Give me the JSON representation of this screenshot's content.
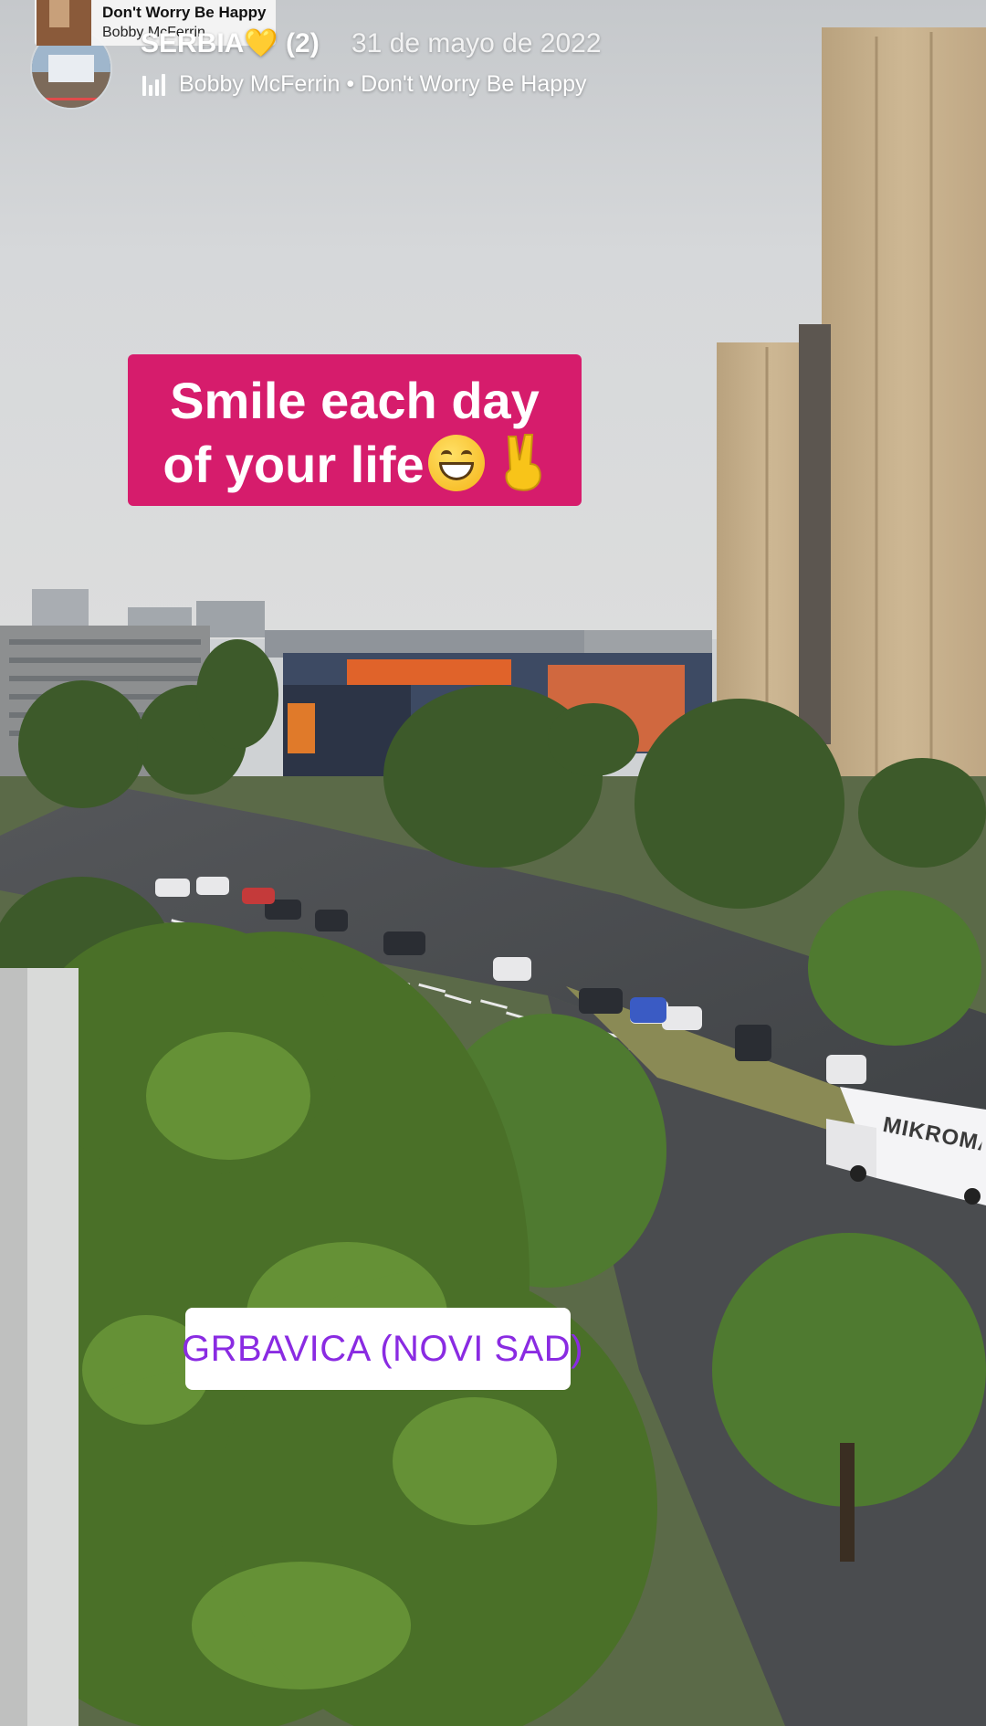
{
  "story": {
    "title": "SERBIA💛",
    "count": "(2)",
    "date": "31 de mayo de 2022",
    "song_line": "Bobby McFerrin • Don't Worry Be Happy"
  },
  "music_card": {
    "title": "Don't Worry Be Happy",
    "artist": "Bobby McFerrin"
  },
  "caption": {
    "line1": "Smile each day",
    "line2": "of your life"
  },
  "location": {
    "label": "GRBAVICA (NOVI SAD)"
  },
  "photo": {
    "truck_text": "MIKROMAR"
  },
  "colors": {
    "caption_bg": "#d61c6c",
    "location_text": "#8a2be2",
    "sky": "#d3d5d7",
    "tower": "#c8b28f"
  },
  "icons": [
    "equalizer-icon",
    "location-pin-icon",
    "grinning-face-emoji",
    "victory-hand-emoji"
  ]
}
